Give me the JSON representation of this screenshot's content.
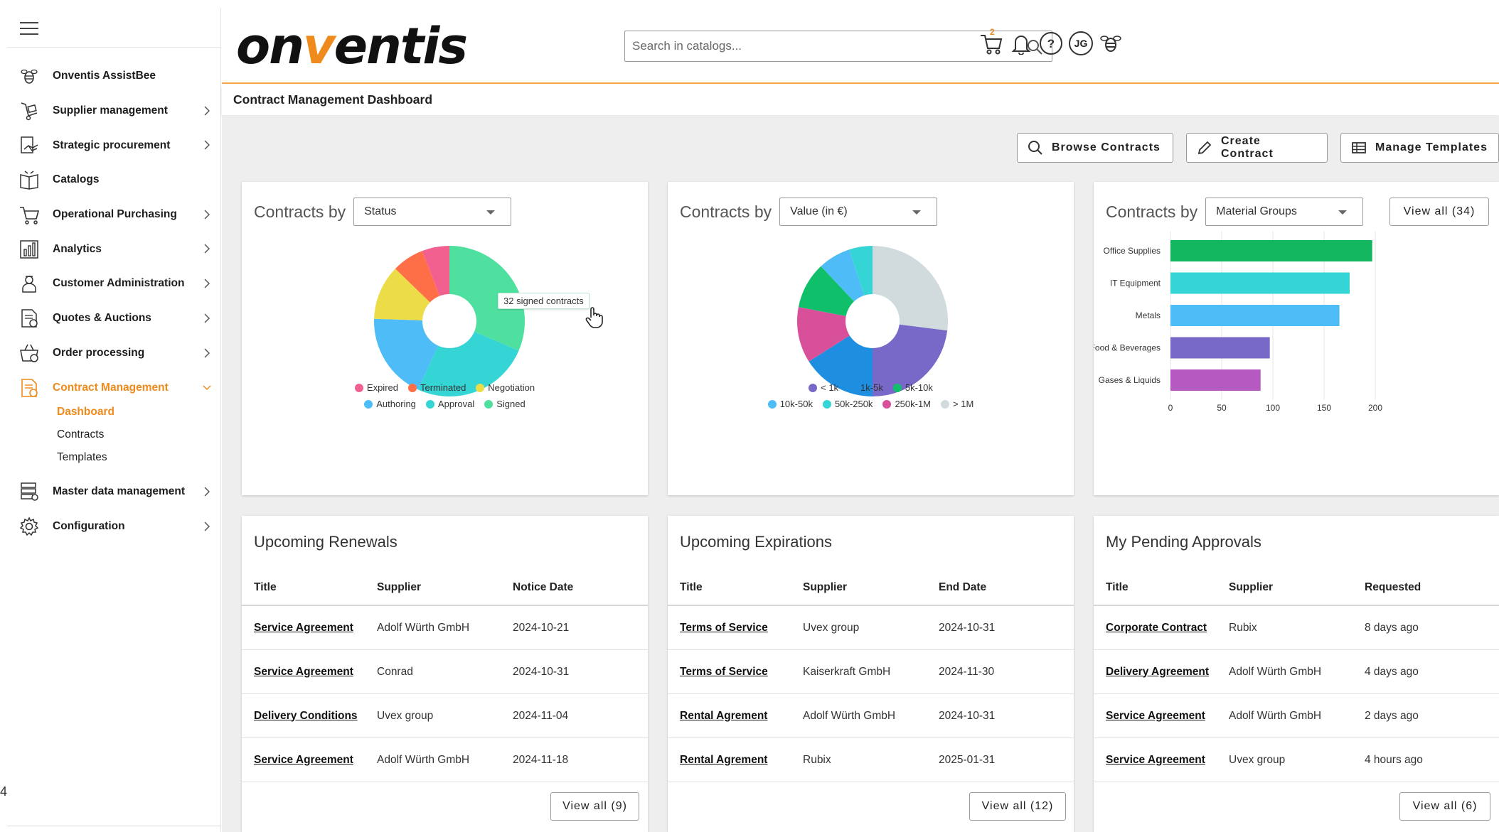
{
  "stray_text": "4",
  "sidebar": {
    "items": [
      {
        "label": "Onventis AssistBee",
        "icon": "bee-icon",
        "chevron": false
      },
      {
        "label": "Supplier management",
        "icon": "supplier-icon",
        "chevron": true
      },
      {
        "label": "Strategic procurement",
        "icon": "handshake-icon",
        "chevron": true
      },
      {
        "label": "Catalogs",
        "icon": "catalog-book-icon",
        "chevron": false
      },
      {
        "label": "Operational Purchasing",
        "icon": "cart-icon",
        "chevron": true
      },
      {
        "label": "Analytics",
        "icon": "bar-chart-icon",
        "chevron": true
      },
      {
        "label": "Customer Administration",
        "icon": "user-admin-icon",
        "chevron": true
      },
      {
        "label": "Quotes & Auctions",
        "icon": "quote-document-icon",
        "chevron": true
      },
      {
        "label": "Order processing",
        "icon": "basket-clock-icon",
        "chevron": true
      },
      {
        "label": "Contract Management",
        "icon": "contract-icon",
        "chevron": true,
        "active": true
      }
    ],
    "subitems": [
      {
        "label": "Dashboard",
        "active": true
      },
      {
        "label": "Contracts"
      },
      {
        "label": "Templates"
      }
    ],
    "items_after": [
      {
        "label": "Master data management",
        "icon": "database-icon",
        "chevron": true
      },
      {
        "label": "Configuration",
        "icon": "gear-icon",
        "chevron": true
      }
    ]
  },
  "header": {
    "logo_pre": "on",
    "logo_v": "v",
    "logo_post": "entis",
    "search_placeholder": "Search in catalogs...",
    "cart_count": "2",
    "avatar_initials": "JG"
  },
  "breadcrumb": "Contract Management Dashboard",
  "toolbar": {
    "browse": "Browse Contracts",
    "create": "Create Contract",
    "templates": "Manage Templates"
  },
  "charts": {
    "contracts_by_label": "Contracts by",
    "status_select": "Status",
    "value_select": "Value (in €)",
    "material_select": "Material Groups",
    "material_view_all": "View all (34)",
    "tooltip": "32 signed contracts"
  },
  "chart_data": [
    {
      "type": "pie",
      "slices": [
        {
          "label": "Signed",
          "value": 32,
          "color": "#4fe09f"
        },
        {
          "label": "Approval",
          "value": 26,
          "color": "#35d5d5"
        },
        {
          "label": "Authoring",
          "value": 19,
          "color": "#4ebcf6"
        },
        {
          "label": "Negotiation",
          "value": 12,
          "color": "#ecdc48"
        },
        {
          "label": "Terminated",
          "value": 7,
          "color": "#ff6f47"
        },
        {
          "label": "Expired",
          "value": 6,
          "color": "#f2608f"
        }
      ],
      "legend_rows": [
        [
          "Expired",
          "Terminated",
          "Negotiation"
        ],
        [
          "Authoring",
          "Approval",
          "Signed"
        ]
      ]
    },
    {
      "type": "pie",
      "slices": [
        {
          "label": "> 1M",
          "value": 27,
          "color": "#d1dadc"
        },
        {
          "label": "< 1k",
          "value": 23,
          "color": "#7868c8"
        },
        {
          "label": "1k-5k",
          "value": 16,
          "color": "#1e8ee0"
        },
        {
          "label": "250k-1M",
          "value": 12,
          "color": "#d9509a"
        },
        {
          "label": "5k-10k",
          "value": 10,
          "color": "#0fbf6a"
        },
        {
          "label": "10k-50k",
          "value": 7,
          "color": "#4ebcf6"
        },
        {
          "label": "50k-250k",
          "value": 5,
          "color": "#35d5d5"
        }
      ],
      "legend_rows": [
        [
          "< 1k",
          "1k-5k",
          "5k-10k"
        ],
        [
          "10k-50k",
          "50k-250k",
          "250k-1M",
          "> 1M"
        ]
      ]
    },
    {
      "type": "bar",
      "orientation": "horizontal",
      "categories": [
        "Office Supplies",
        "IT Equipment",
        "Metals",
        "Food & Beverages",
        "Gases & Liquids"
      ],
      "values": [
        197,
        175,
        165,
        97,
        88
      ],
      "colors": [
        "#11b65f",
        "#35d5d5",
        "#4ebcf6",
        "#7868c8",
        "#b55ac0"
      ],
      "xlim": [
        0,
        200
      ],
      "xticks": [
        0,
        50,
        100,
        150,
        200
      ],
      "grid": true
    }
  ],
  "chart_colors": {
    "Expired": "#f2608f",
    "Terminated": "#ff6f47",
    "Negotiation": "#ecdc48",
    "Authoring": "#4ebcf6",
    "Approval": "#35d5d5",
    "Signed": "#4fe09f",
    "< 1k": "#7868c8",
    "1k-5k": "#1e8ee0",
    "5k-10k": "#0fbf6a",
    "10k-50k": "#4ebcf6",
    "50k-250k": "#35d5d5",
    "250k-1M": "#d9509a",
    "> 1M": "#d1dadc"
  },
  "renewals": {
    "title": "Upcoming Renewals",
    "headers": [
      "Title",
      "Supplier",
      "Notice Date"
    ],
    "rows": [
      [
        "Service Agreement",
        "Adolf Würth GmbH",
        "2024-10-21"
      ],
      [
        "Service Agreement",
        "Conrad",
        "2024-10-31"
      ],
      [
        "Delivery Conditions",
        "Uvex group",
        "2024-11-04"
      ],
      [
        "Service Agreement",
        "Adolf Würth GmbH",
        "2024-11-18"
      ]
    ],
    "view_all": "View all (9)"
  },
  "expirations": {
    "title": "Upcoming Expirations",
    "headers": [
      "Title",
      "Supplier",
      "End Date"
    ],
    "rows": [
      [
        "Terms of Service",
        "Uvex group",
        "2024-10-31"
      ],
      [
        "Terms of Service",
        "Kaiserkraft GmbH",
        "2024-11-30"
      ],
      [
        "Rental Agrement",
        "Adolf Würth GmbH",
        "2024-10-31"
      ],
      [
        "Rental Agrement",
        "Rubix",
        "2025-01-31"
      ]
    ],
    "view_all": "View all (12)"
  },
  "approvals": {
    "title": "My Pending Approvals",
    "headers": [
      "Title",
      "Supplier",
      "Requested"
    ],
    "rows": [
      [
        "Corporate Contract",
        "Rubix",
        "8 days ago"
      ],
      [
        "Delivery Agreement",
        "Adolf Würth GmbH",
        "4 days ago"
      ],
      [
        "Service Agreement",
        "Adolf Würth GmbH",
        "2 days ago"
      ],
      [
        "Service Agreement",
        "Uvex group",
        "4 hours ago"
      ]
    ],
    "view_all": "View all (6)"
  }
}
